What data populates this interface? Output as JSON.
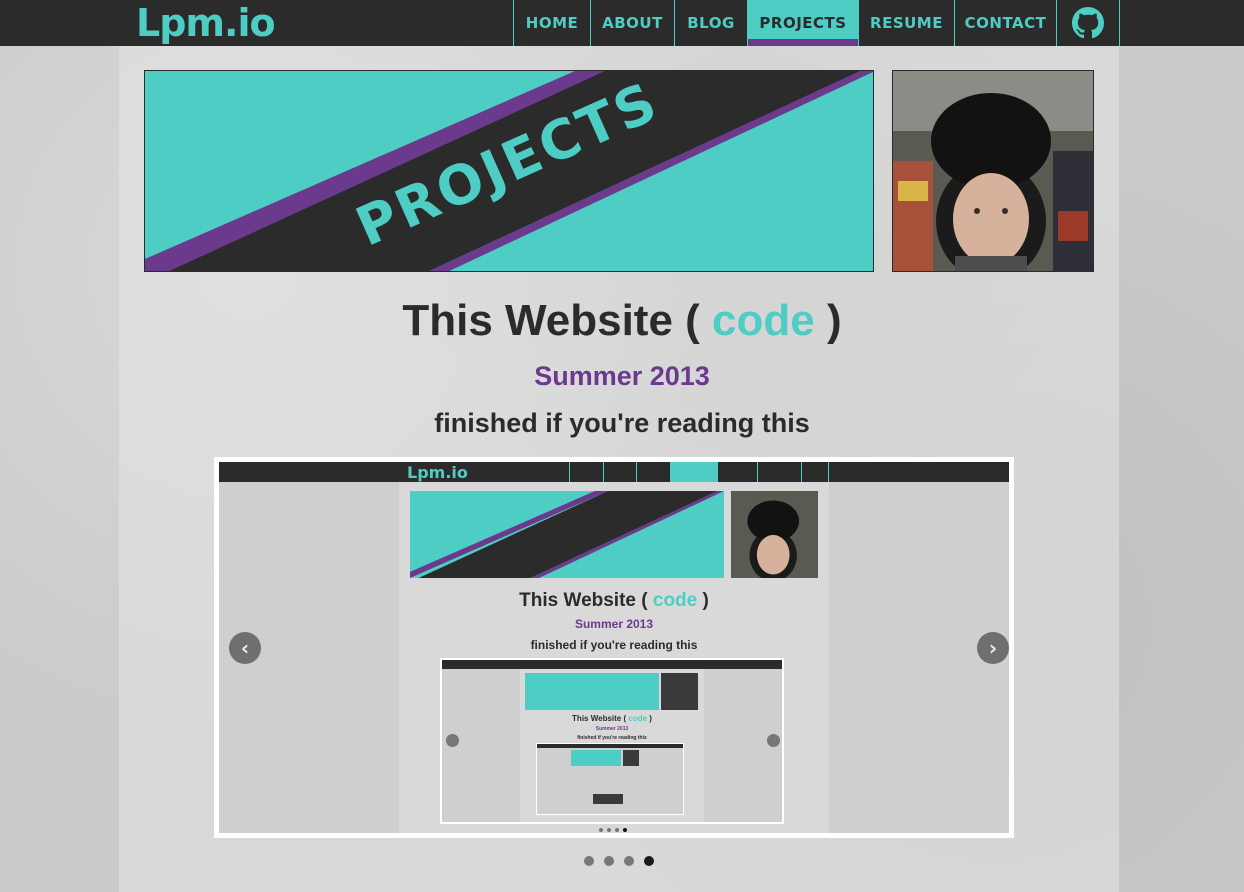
{
  "site": {
    "logo": "Lpm.io",
    "colors": {
      "accent": "#4ecdc4",
      "dark": "#2b2b2b",
      "purple": "#6b3a8c"
    }
  },
  "nav": {
    "items": [
      {
        "label": "HOME",
        "active": false
      },
      {
        "label": "ABOUT",
        "active": false
      },
      {
        "label": "BLOG",
        "active": false
      },
      {
        "label": "PROJECTS",
        "active": true
      },
      {
        "label": "RESUME",
        "active": false
      },
      {
        "label": "CONTACT",
        "active": false
      }
    ],
    "github_icon": "github-icon"
  },
  "banner": {
    "text": "PROJECTS"
  },
  "project": {
    "title_prefix": "This Website (",
    "title_link": "code",
    "title_suffix": ")",
    "date": "Summer 2013",
    "description": "finished if you're reading this"
  },
  "carousel": {
    "prev_icon": "chevron-left-icon",
    "next_icon": "chevron-right-icon",
    "dots": [
      false,
      false,
      false,
      true
    ]
  }
}
